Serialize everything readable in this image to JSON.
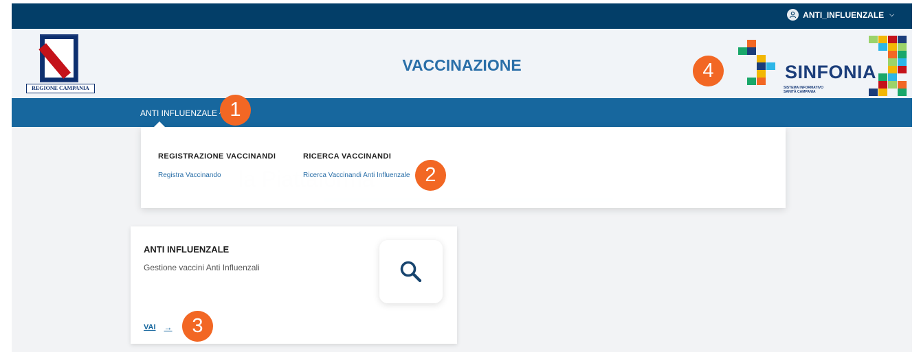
{
  "topbar": {
    "user_label": "ANTI_INFLUENZALE"
  },
  "header": {
    "title": "VACCINAZIONE",
    "region_label": "REGIONE CAMPANIA",
    "brand_name": "SINFONIA",
    "brand_sub_1": "SISTEMA INFORMATIVO",
    "brand_sub_2": "SANITÀ CAMPANIA"
  },
  "nav": {
    "item_label": "ANTI INFLUENZALE"
  },
  "dropdown": {
    "columns": [
      {
        "heading": "REGISTRAZIONE VACCINANDI",
        "link": "Registra Vaccinando"
      },
      {
        "heading": "RICERCA VACCINANDI",
        "link": "Ricerca Vaccinandi Anti Influenzale"
      }
    ]
  },
  "card": {
    "title": "ANTI INFLUENZALE",
    "description": "Gestione vaccini Anti Influenzali",
    "action_label": "VAI",
    "action_arrow": "→",
    "icon": "search-icon"
  },
  "badges": [
    "1",
    "2",
    "3",
    "4"
  ],
  "colors": {
    "topbar": "#033e68",
    "navbar": "#17679e",
    "title": "#2a6fa8",
    "badge": "#f26724"
  }
}
